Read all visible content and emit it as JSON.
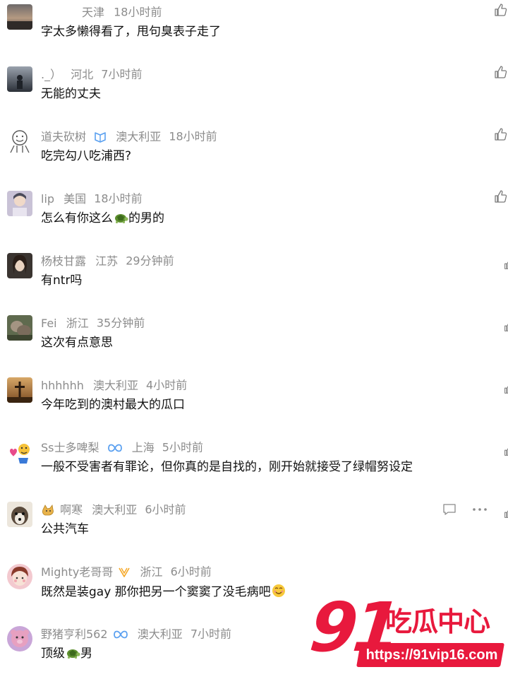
{
  "comments": [
    {
      "username": "天津",
      "location": "",
      "time": "18小时前",
      "text": "字太多懒得看了，甩句臭表子走了"
    },
    {
      "username": "._）",
      "location": "河北",
      "time": "7小时前",
      "text": "无能的丈夫"
    },
    {
      "username": "道夫砍树",
      "location": "澳大利亚",
      "time": "18小时前",
      "text": "吃完勾八吃浦西?"
    },
    {
      "username": "lip",
      "location": "美国",
      "time": "18小时前",
      "text_before": "怎么有你这么",
      "text_after": "的男的"
    },
    {
      "username": "杨枝甘露",
      "location": "江苏",
      "time": "29分钟前",
      "text": "有ntr吗"
    },
    {
      "username": "Fei",
      "location": "浙江",
      "time": "35分钟前",
      "text": "这次有点意思"
    },
    {
      "username": "hhhhhh",
      "location": "澳大利亚",
      "time": "4小时前",
      "text": "今年吃到的澳村最大的瓜口"
    },
    {
      "username": "Ss士多啤梨",
      "location": "上海",
      "time": "5小时前",
      "text": "一般不受害者有罪论，但你真的是自找的，刚开始就接受了绿帽努设定"
    },
    {
      "username": "啊寒",
      "location": "澳大利亚",
      "time": "6小时前",
      "text": "公共汽车"
    },
    {
      "username": "Mighty老哥哥",
      "location": "浙江",
      "time": "6小时前",
      "text": "既然是装gay 那你把另一个窦窦了没毛病吧"
    },
    {
      "username": "野猪亨利562",
      "location": "澳大利亚",
      "time": "7小时前",
      "text_before": "顶级",
      "text_after": "男"
    }
  ],
  "watermark": {
    "number": "91",
    "name": "吃瓜中心",
    "url": "https://91vip16.com"
  },
  "icons": {
    "like": "thumbs-up-icon",
    "reply": "reply-icon",
    "more": "more-icon",
    "badge": "verified-badge-icon",
    "turtle": "turtle-emoji-icon",
    "smile": "smile-emoji-icon"
  },
  "colors": {
    "meta": "#8c8c8c",
    "text": "#111111",
    "badge_blue": "#5aa0f0",
    "badge_orange": "#f5a623",
    "watermark_red": "#e8193d"
  }
}
